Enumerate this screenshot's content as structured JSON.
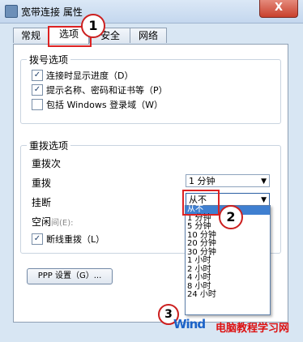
{
  "window": {
    "title": "宽带连接 属性",
    "close_label": "X"
  },
  "tabs": [
    "常规",
    "选项",
    "安全",
    "网络"
  ],
  "dial_options": {
    "title": "拨号选项",
    "items": [
      {
        "label": "连接时显示进度（D）",
        "checked": true
      },
      {
        "label": "提示名称、密码和证书等（P）",
        "checked": true
      },
      {
        "label": "包括 Windows 登录域（W）",
        "checked": false
      }
    ]
  },
  "redial_options": {
    "title": "重拨选项",
    "redial_attempts_label": "重拨次",
    "redial_interval_label": "重拨",
    "redial_interval_value": "1 分钟",
    "idle_hangup_label": "挂断",
    "idle_hangup_value": "从不",
    "idle_label": "空闲",
    "idle_suffix": "间(E):",
    "redial_if_dropped": {
      "label": "断线重拨（L）",
      "checked": true
    }
  },
  "dropdown": {
    "items": [
      "从不",
      "1 分钟",
      "5 分钟",
      "10 分钟",
      "20 分钟",
      "30 分钟",
      "1 小时",
      "2 小时",
      "4 小时",
      "8 小时",
      "24 小时"
    ],
    "selected_index": 0
  },
  "ppp_button": "PPP 设置（G）...",
  "markers": [
    "1",
    "2",
    "3"
  ],
  "watermark": {
    "part1": "Wind",
    "part2": "电脑教程学习网",
    "part3": ""
  }
}
